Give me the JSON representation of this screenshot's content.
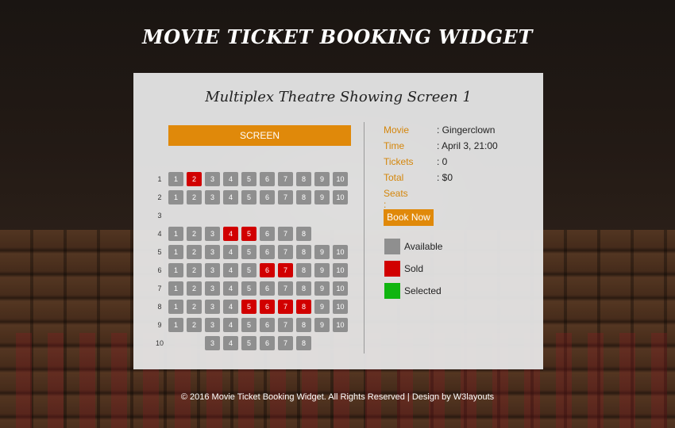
{
  "header": {
    "title": "MOVIE TICKET BOOKING WIDGET"
  },
  "panel": {
    "title": "Multiplex Theatre Showing Screen 1",
    "screen_label": "SCREEN"
  },
  "seat_colors": {
    "available": "#8f8f8f",
    "sold": "#d10000",
    "selected": "#10b510"
  },
  "seat_map": [
    {
      "row": "1",
      "seats": [
        1,
        2,
        3,
        4,
        5,
        6,
        7,
        8,
        9,
        10
      ],
      "sold": [
        2
      ]
    },
    {
      "row": "2",
      "seats": [
        1,
        2,
        3,
        4,
        5,
        6,
        7,
        8,
        9,
        10
      ],
      "sold": []
    },
    {
      "row": "3",
      "seats": [],
      "sold": []
    },
    {
      "row": "4",
      "seats": [
        1,
        2,
        3,
        4,
        5,
        6,
        7,
        8
      ],
      "sold": [
        4,
        5
      ]
    },
    {
      "row": "5",
      "seats": [
        1,
        2,
        3,
        4,
        5,
        6,
        7,
        8,
        9,
        10
      ],
      "sold": []
    },
    {
      "row": "6",
      "seats": [
        1,
        2,
        3,
        4,
        5,
        6,
        7,
        8,
        9,
        10
      ],
      "sold": [
        6,
        7
      ]
    },
    {
      "row": "7",
      "seats": [
        1,
        2,
        3,
        4,
        5,
        6,
        7,
        8,
        9,
        10
      ],
      "sold": []
    },
    {
      "row": "8",
      "seats": [
        1,
        2,
        3,
        4,
        5,
        6,
        7,
        8,
        9,
        10
      ],
      "sold": [
        5,
        6,
        7,
        8
      ]
    },
    {
      "row": "9",
      "seats": [
        1,
        2,
        3,
        4,
        5,
        6,
        7,
        8,
        9,
        10
      ],
      "sold": []
    },
    {
      "row": "10",
      "seats": [
        3,
        4,
        5,
        6,
        7,
        8
      ],
      "sold": []
    }
  ],
  "booking_info": {
    "movie_label": "Movie",
    "movie_value": ": Gingerclown",
    "time_label": "Time",
    "time_value": ": April 3, 21:00",
    "tickets_label": "Tickets",
    "tickets_value": ": 0",
    "total_label": "Total",
    "total_value": ": $0",
    "seats_label": "Seats :"
  },
  "book_button": "Book Now",
  "legend": {
    "available": "Available",
    "sold": "Sold",
    "selected": "Selected"
  },
  "footer": {
    "text": "© 2016 Movie Ticket Booking Widget. All Rights Reserved | Design by W3layouts"
  }
}
